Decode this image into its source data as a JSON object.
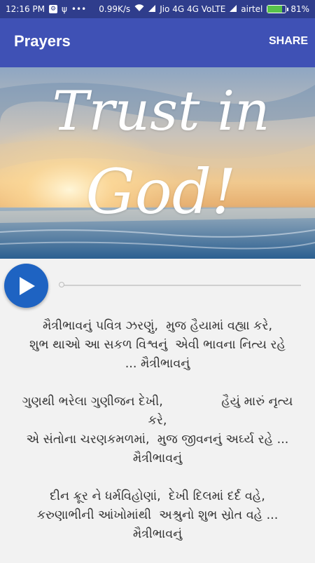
{
  "status_bar": {
    "time": "12:16 PM",
    "speed": "0.99K/s",
    "carrier1": "Jio 4G 4G VoLTE",
    "carrier2": "airtel",
    "battery": "81%",
    "battery_level": 0.81
  },
  "app_bar": {
    "title": "Prayers",
    "share_label": "SHARE"
  },
  "hero": {
    "line1": "Trust in",
    "line2": "God!"
  },
  "player": {
    "progress": 0
  },
  "lyrics": [
    {
      "lines": [
        "મૈત્રીભાવનું પવિત્ર ઝરણું,  મુજ હૈયામાં વહ્યા કરે,",
        "શુભ થાઓ આ સકળ વિશ્વનું  એવી ભાવના નિત્ય રહે",
        "... મૈત્રીભાવનું"
      ]
    },
    {
      "lines": [
        "ગુણથી ભરેલા ગુણીજન દેખી,               હૈયું મારું નૃત્ય",
        "કરે,",
        "એ સંતોના ચરણકમળમાં,  મુજ જીવનનું અર્ઘ્ય રહે ...",
        "મૈત્રીભાવનું"
      ]
    },
    {
      "lines": [
        "દીન ક્રૂર ને ધર્મવિહોણાં,  દેખી દિલમાં દર્દ વહે,",
        "કરુણાભીની આંખોમાંથી  અશ્રુનો શુભ સ્રોત વહે ...",
        "મૈત્રીભાવનું"
      ]
    }
  ]
}
